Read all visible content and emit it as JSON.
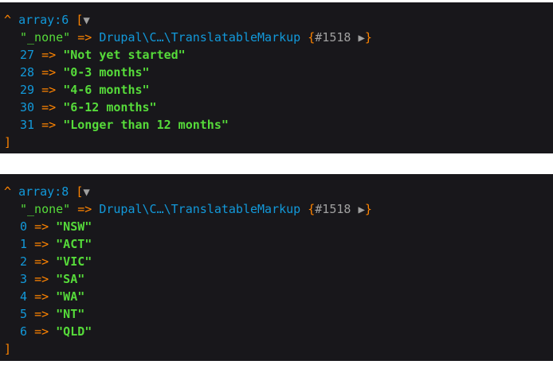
{
  "dumps": [
    {
      "caret": "^",
      "type_note": "array:6",
      "open_bracket": "[",
      "toggle": "▼",
      "none_key": "\"_none\"",
      "arrow": "=>",
      "class_name": "Drupal\\C…\\TranslatableMarkup",
      "ref_open": "{",
      "ref_id": "#1518",
      "ref_toggle": "▶",
      "ref_close": "}",
      "items": [
        {
          "key": "27",
          "value": "\"Not yet started\""
        },
        {
          "key": "28",
          "value": "\"0-3 months\""
        },
        {
          "key": "29",
          "value": "\"4-6 months\""
        },
        {
          "key": "30",
          "value": "\"6-12 months\""
        },
        {
          "key": "31",
          "value": "\"Longer than 12 months\""
        }
      ],
      "close_bracket": "]"
    },
    {
      "caret": "^",
      "type_note": "array:8",
      "open_bracket": "[",
      "toggle": "▼",
      "none_key": "\"_none\"",
      "arrow": "=>",
      "class_name": "Drupal\\C…\\TranslatableMarkup",
      "ref_open": "{",
      "ref_id": "#1518",
      "ref_toggle": "▶",
      "ref_close": "}",
      "items": [
        {
          "key": "0",
          "value": "\"NSW\""
        },
        {
          "key": "1",
          "value": "\"ACT\""
        },
        {
          "key": "2",
          "value": "\"VIC\""
        },
        {
          "key": "3",
          "value": "\"SA\""
        },
        {
          "key": "4",
          "value": "\"WA\""
        },
        {
          "key": "5",
          "value": "\"NT\""
        },
        {
          "key": "6",
          "value": "\"QLD\""
        }
      ],
      "close_bracket": "]"
    }
  ],
  "colors": {
    "background": "#18171b",
    "orange": "#ff8400",
    "blue": "#1299da",
    "green": "#56db3a",
    "grey": "#a0a0a0"
  }
}
